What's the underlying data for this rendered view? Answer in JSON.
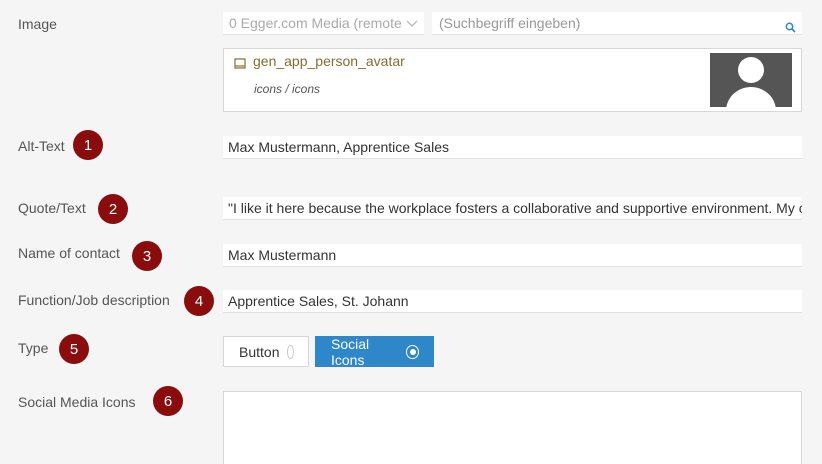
{
  "labels": {
    "image": "Image",
    "alt_text": "Alt-Text",
    "quote_text": "Quote/Text",
    "name_of_contact": "Name of contact",
    "function": "Function/Job description",
    "type": "Type",
    "social_media_icons": "Social Media Icons"
  },
  "badges": [
    "1",
    "2",
    "3",
    "4",
    "5",
    "6"
  ],
  "image_picker": {
    "source_select_value": "0 Egger.com Media (remote",
    "search_placeholder": "(Suchbegriff eingeben)",
    "selected_media": {
      "name": "gen_app_person_avatar",
      "path": "icons / icons"
    }
  },
  "fields": {
    "alt_text": "Max Mustermann, Apprentice Sales",
    "quote_text": "\"I like it here because the workplace fosters a collaborative and supportive environment. My co",
    "name_of_contact": "Max Mustermann",
    "function": "Apprentice Sales, St. Johann",
    "social_media_icons": ""
  },
  "type_options": {
    "button": "Button",
    "social_icons": "Social Icons",
    "selected": "social_icons"
  },
  "colors": {
    "badge": "#8b0c0c",
    "accent": "#2d87c8",
    "media_name": "#8a6a2e"
  }
}
